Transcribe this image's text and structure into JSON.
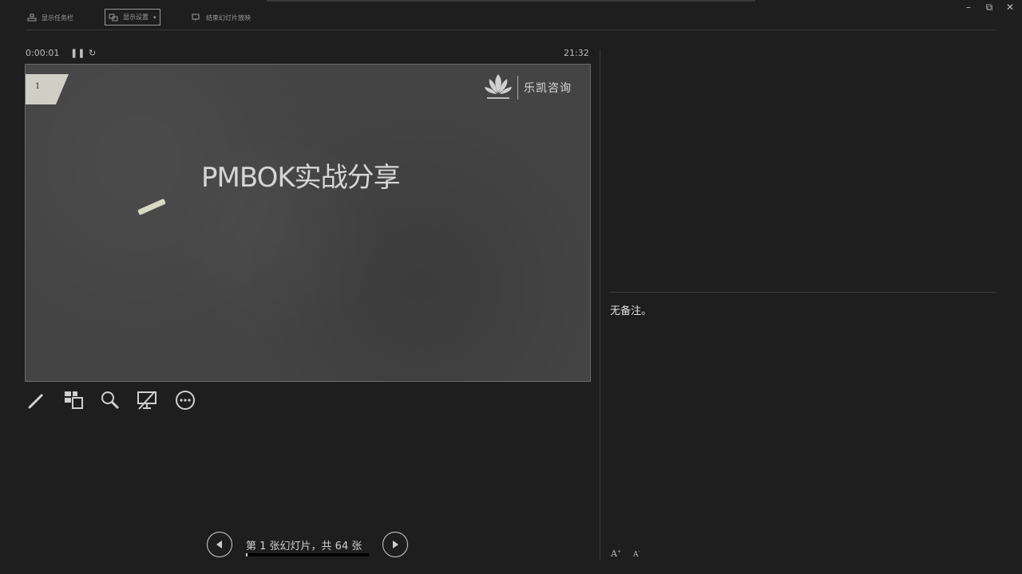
{
  "toolbar": {
    "show_taskbar_label": "显示任务栏",
    "display_settings_label": "显示设置",
    "end_slideshow_label": "结束幻灯片放映"
  },
  "window": {
    "minimize": "–",
    "restore": "⧉",
    "close": "✕"
  },
  "presenter": {
    "elapsed_time": "0:00:01",
    "clock": "21:32"
  },
  "slide": {
    "number": "1",
    "title": "PMBOK实战分享",
    "logo_text": "乐凯咨询"
  },
  "notes": {
    "text": "无备注。",
    "increase_font": "A",
    "decrease_font": "A"
  },
  "navigation": {
    "label": "第 1 张幻灯片，共 64 张",
    "progress_fraction": 0.0156
  }
}
